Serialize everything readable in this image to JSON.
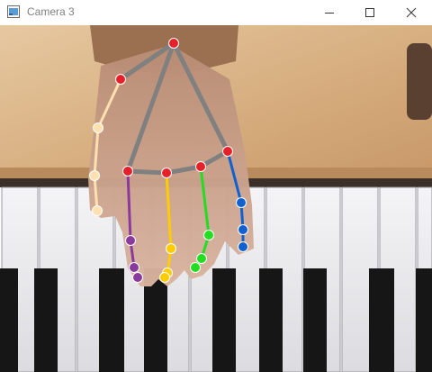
{
  "window": {
    "title": "Camera 3",
    "controls": [
      "minimize-icon",
      "maximize-icon",
      "close-icon"
    ]
  },
  "colors": {
    "thumb": "#ffe0b0",
    "index": "#8a3a9a",
    "middle": "#ffcc00",
    "ring": "#22dd22",
    "pinky": "#1060d0",
    "palm": "#808080",
    "joint": "#e8202a",
    "wood": "#d9b48a",
    "sleeve": "#9a7050"
  },
  "camera_view": {
    "subject": "hand-on-piano-keyboard",
    "landmark_overlay": {
      "connections": [
        "palm",
        "thumb",
        "index",
        "middle",
        "ring",
        "pinky"
      ]
    }
  }
}
